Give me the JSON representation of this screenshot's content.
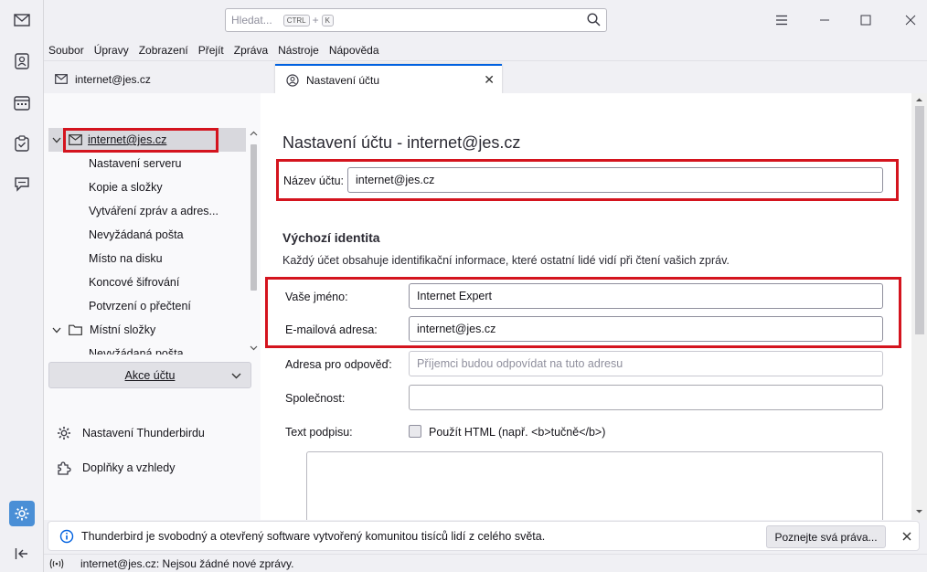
{
  "spaces": {
    "items": [
      "mail-icon",
      "address-book-icon",
      "calendar-icon",
      "tasks-icon",
      "chat-icon"
    ],
    "settings_icon": "gear-icon",
    "collapse_icon": "collapse-left-icon"
  },
  "titlebar": {
    "search_placeholder": "Hledat...",
    "search_shortcut_1": "CTRL",
    "search_plus": "+",
    "search_shortcut_2": "K"
  },
  "menubar": {
    "items": [
      {
        "label": "Soubor"
      },
      {
        "label": "Úpravy"
      },
      {
        "label": "Zobrazení"
      },
      {
        "label": "Přejít"
      },
      {
        "label": "Zpráva"
      },
      {
        "label": "Nástroje"
      },
      {
        "label": "Nápověda"
      }
    ]
  },
  "tabs": [
    {
      "label": "internet@jes.cz",
      "icon": "mail-icon"
    },
    {
      "label": "Nastavení účtu",
      "icon": "account-settings-icon",
      "active": true
    }
  ],
  "tree": {
    "account": "internet@jes.cz",
    "children": [
      "Nastavení serveru",
      "Kopie a složky",
      "Vytváření zpráv a adres...",
      "Nevyžádaná pošta",
      "Místo na disku",
      "Koncové šifrování",
      "Potvrzení o přečtení"
    ],
    "local_folders": "Místní složky",
    "local_child": "Nevyžádaná pošta",
    "action_button": "Akce účtu",
    "links": [
      {
        "label": "Nastavení Thunderbirdu",
        "icon": "gear-icon"
      },
      {
        "label": "Doplňky a vzhledy",
        "icon": "puzzle-icon"
      }
    ]
  },
  "content": {
    "title": "Nastavení účtu - internet@jes.cz",
    "account_name_label": "Název účtu:",
    "account_name_value": "internet@jes.cz",
    "identity_title": "Výchozí identita",
    "identity_desc": "Každý účet obsahuje identifikační informace, které ostatní lidé vidí při čtení vašich zpráv.",
    "fields": {
      "name_label": "Vaše jméno:",
      "name_value": "Internet Expert",
      "email_label": "E-mailová adresa:",
      "email_value": "internet@jes.cz",
      "reply_label": "Adresa pro odpověď:",
      "reply_placeholder": "Příjemci budou odpovídat na tuto adresu",
      "org_label": "Společnost:",
      "org_value": "",
      "sig_label": "Text podpisu:",
      "html_checkbox": "Použít HTML (např. <b>tučně</b>)"
    }
  },
  "notification": {
    "text": "Thunderbird je svobodný a otevřený software vytvořený komunitou tisíců lidí z celého světa.",
    "button": "Poznejte svá práva...",
    "icon": "info-icon"
  },
  "status": {
    "text": "internet@jes.cz: Nejsou žádné nové zprávy.",
    "icon": "wifi-icon"
  },
  "colors": {
    "highlight": "#d4141e",
    "accent": "#0061e0",
    "settings_space": "#4a8fd6"
  }
}
